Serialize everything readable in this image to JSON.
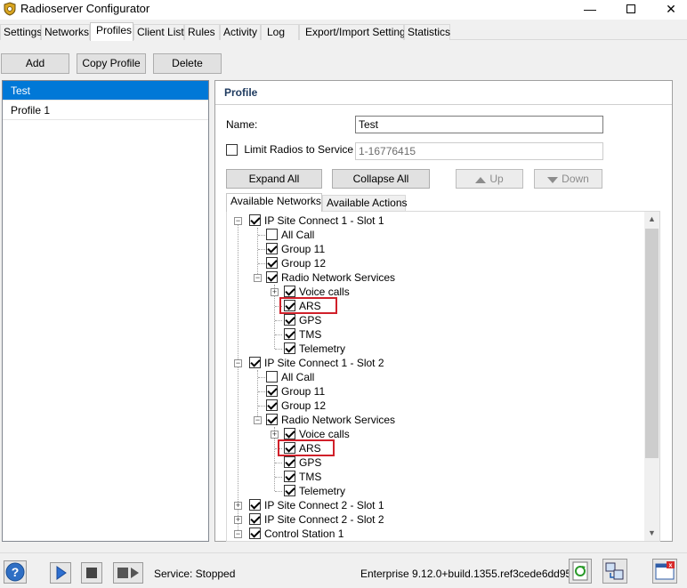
{
  "window": {
    "title": "Radioserver Configurator",
    "minimize": "—",
    "close": "✕"
  },
  "tabs": [
    {
      "label": "Settings"
    },
    {
      "label": "Networks"
    },
    {
      "label": "Profiles",
      "active": true
    },
    {
      "label": "Client List"
    },
    {
      "label": "Rules"
    },
    {
      "label": "Activity"
    },
    {
      "label": "Log"
    },
    {
      "label": "Export/Import Settings"
    },
    {
      "label": "Statistics"
    }
  ],
  "toolbar": {
    "add_label": "Add",
    "copy_label": "Copy Profile",
    "delete_label": "Delete"
  },
  "profiles_list": [
    {
      "name": "Test",
      "selected": true
    },
    {
      "name": "Profile 1"
    }
  ],
  "profile": {
    "header": "Profile",
    "name_label": "Name:",
    "name_value": "Test",
    "limit_label": "Limit Radios to Service",
    "limit_checked": false,
    "limit_value": "1-16776415",
    "expand_all": "Expand All",
    "collapse_all": "Collapse All",
    "up": "Up",
    "down": "Down",
    "tab_networks": "Available Networks",
    "tab_actions": "Available Actions"
  },
  "tree": {
    "site1": {
      "label": "IP Site Connect 1 - Slot 1",
      "all_call": "All Call",
      "group11": "Group 11",
      "group12": "Group 12",
      "rns": "Radio Network Services",
      "voice": "Voice calls",
      "ars": "ARS",
      "gps": "GPS",
      "tms": "TMS",
      "telemetry": "Telemetry"
    },
    "site2": {
      "label": "IP Site Connect 1 - Slot 2",
      "all_call": "All Call",
      "group11": "Group 11",
      "group12": "Group 12",
      "rns": "Radio Network Services",
      "voice": "Voice calls",
      "ars": "ARS",
      "gps": "GPS",
      "tms": "TMS",
      "telemetry": "Telemetry"
    },
    "site3": {
      "label": "IP Site Connect 2 - Slot 1"
    },
    "site4": {
      "label": "IP Site Connect 2 - Slot 2"
    },
    "site5": {
      "label": "Control Station 1"
    }
  },
  "status": {
    "service": "Service:  Stopped",
    "version": "Enterprise 9.12.0+build.1355.ref3cede6dd95"
  },
  "colors": {
    "selection": "#0078d7",
    "highlight": "#d0202a"
  }
}
